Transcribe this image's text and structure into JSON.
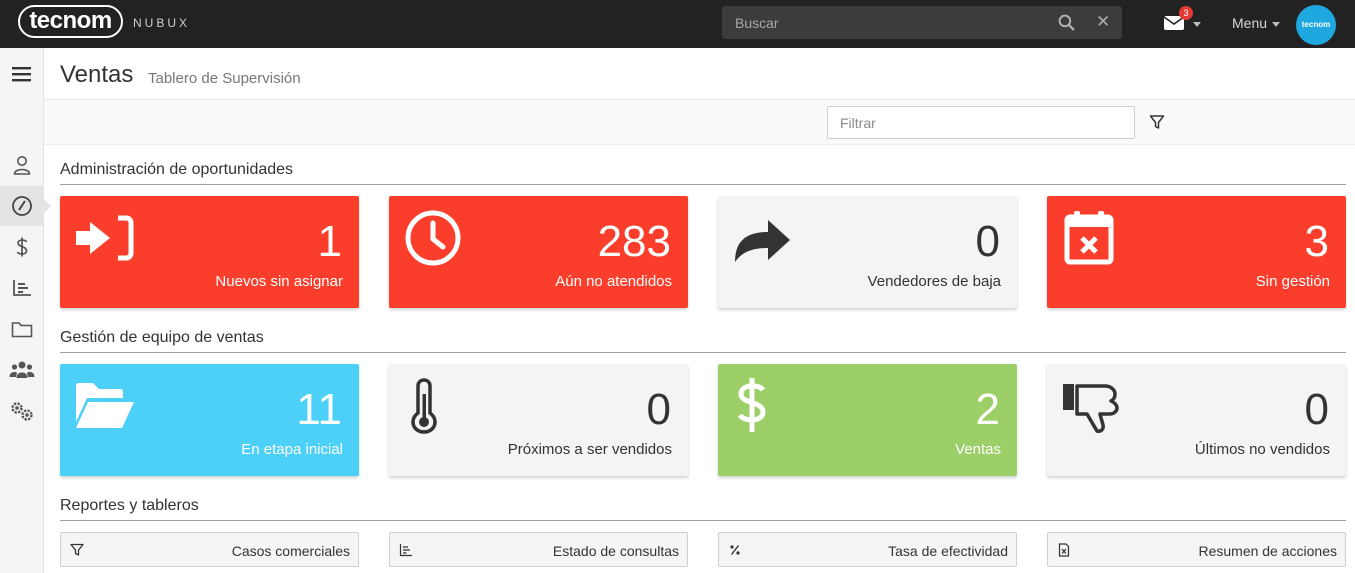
{
  "topbar": {
    "logo_text": "tecnom",
    "logo_sub": "NUBUX",
    "search_placeholder": "Buscar",
    "mail_badge": "3",
    "menu_label": "Menu",
    "avatar_text": "tecnom"
  },
  "header": {
    "title": "Ventas",
    "subtitle": "Tablero de Supervisión",
    "filter_placeholder": "Filtrar"
  },
  "sections": {
    "oportunidades": {
      "title": "Administración de oportunidades",
      "cards": [
        {
          "value": "1",
          "label": "Nuevos sin asignar",
          "icon": "sign-in-icon",
          "color": "#fa3e2b"
        },
        {
          "value": "283",
          "label": "Aún no atendidos",
          "icon": "clock-icon",
          "color": "#fa3e2b"
        },
        {
          "value": "0",
          "label": "Vendedores de baja",
          "icon": "share-arrow-icon",
          "color": "#f4f4f4"
        },
        {
          "value": "3",
          "label": "Sin gestión",
          "icon": "calendar-x-icon",
          "color": "#fa3e2b"
        }
      ]
    },
    "equipo": {
      "title": "Gestión de equipo de ventas",
      "cards": [
        {
          "value": "11",
          "label": "En etapa inicial",
          "icon": "folder-open-icon",
          "color": "#4dd0f7"
        },
        {
          "value": "0",
          "label": "Próximos a ser vendidos",
          "icon": "thermometer-icon",
          "color": "#f4f4f4"
        },
        {
          "value": "2",
          "label": "Ventas",
          "icon": "dollar-icon",
          "color": "#9ccf67"
        },
        {
          "value": "0",
          "label": "Últimos no vendidos",
          "icon": "thumbs-down-icon",
          "color": "#f4f4f4"
        }
      ]
    },
    "reportes": {
      "title": "Reportes y tableros",
      "buttons": [
        {
          "label": "Casos comerciales",
          "icon": "funnel-icon"
        },
        {
          "label": "Estado de consultas",
          "icon": "bar-chart-icon"
        },
        {
          "label": "Tasa de efectividad",
          "icon": "percent-icon"
        },
        {
          "label": "Resumen de acciones",
          "icon": "excel-file-icon"
        }
      ]
    }
  },
  "sidebar": {
    "items": [
      "hamburger-icon",
      "user-icon",
      "dashboard-icon",
      "dollar-icon",
      "chart-icon",
      "folder-icon",
      "team-icon",
      "settings-icon"
    ],
    "active": "dashboard-icon"
  }
}
